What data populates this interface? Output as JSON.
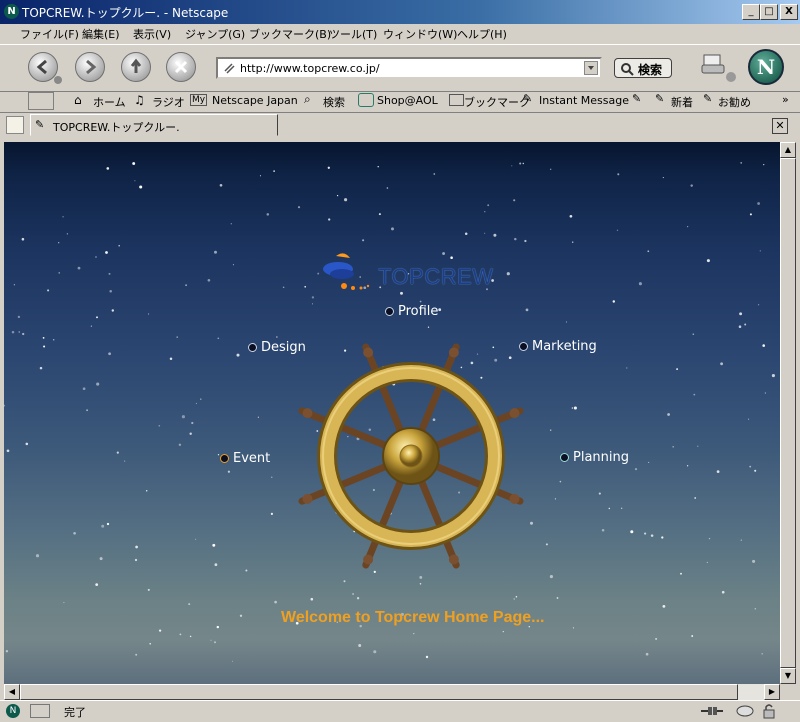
{
  "window": {
    "title": "TOPCREW.トップクルー. - Netscape",
    "minimize": "_",
    "maximize": "□",
    "close": "X"
  },
  "menu": [
    "ファイル(F)",
    "編集(E)",
    "表示(V)",
    "ジャンプ(G)",
    "ブックマーク(B)",
    "ツール(T)",
    "ウィンドウ(W)",
    "ヘルプ(H)"
  ],
  "nav": {
    "url": "http://www.topcrew.co.jp/",
    "search_label": "検索"
  },
  "personal_toolbar": [
    "ホーム",
    "ラジオ",
    "My",
    "Netscape Japan",
    "検索",
    "Shop@AOL",
    "ブックマーク",
    "Instant Message",
    "新着",
    "お勧め",
    "»"
  ],
  "tab": {
    "label": "TOPCREW.トップクルー."
  },
  "page": {
    "logo": "TOPCREW",
    "links": {
      "profile": "Profile",
      "design": "Design",
      "marketing": "Marketing",
      "event": "Event",
      "planning": "Planning"
    },
    "welcome": "Welcome to Topcrew Home Page..."
  },
  "status": {
    "text": "完了"
  },
  "colors": {
    "welcome": "#f0a020",
    "titlebar": "#0a246a",
    "chrome": "#d4d0c8"
  }
}
